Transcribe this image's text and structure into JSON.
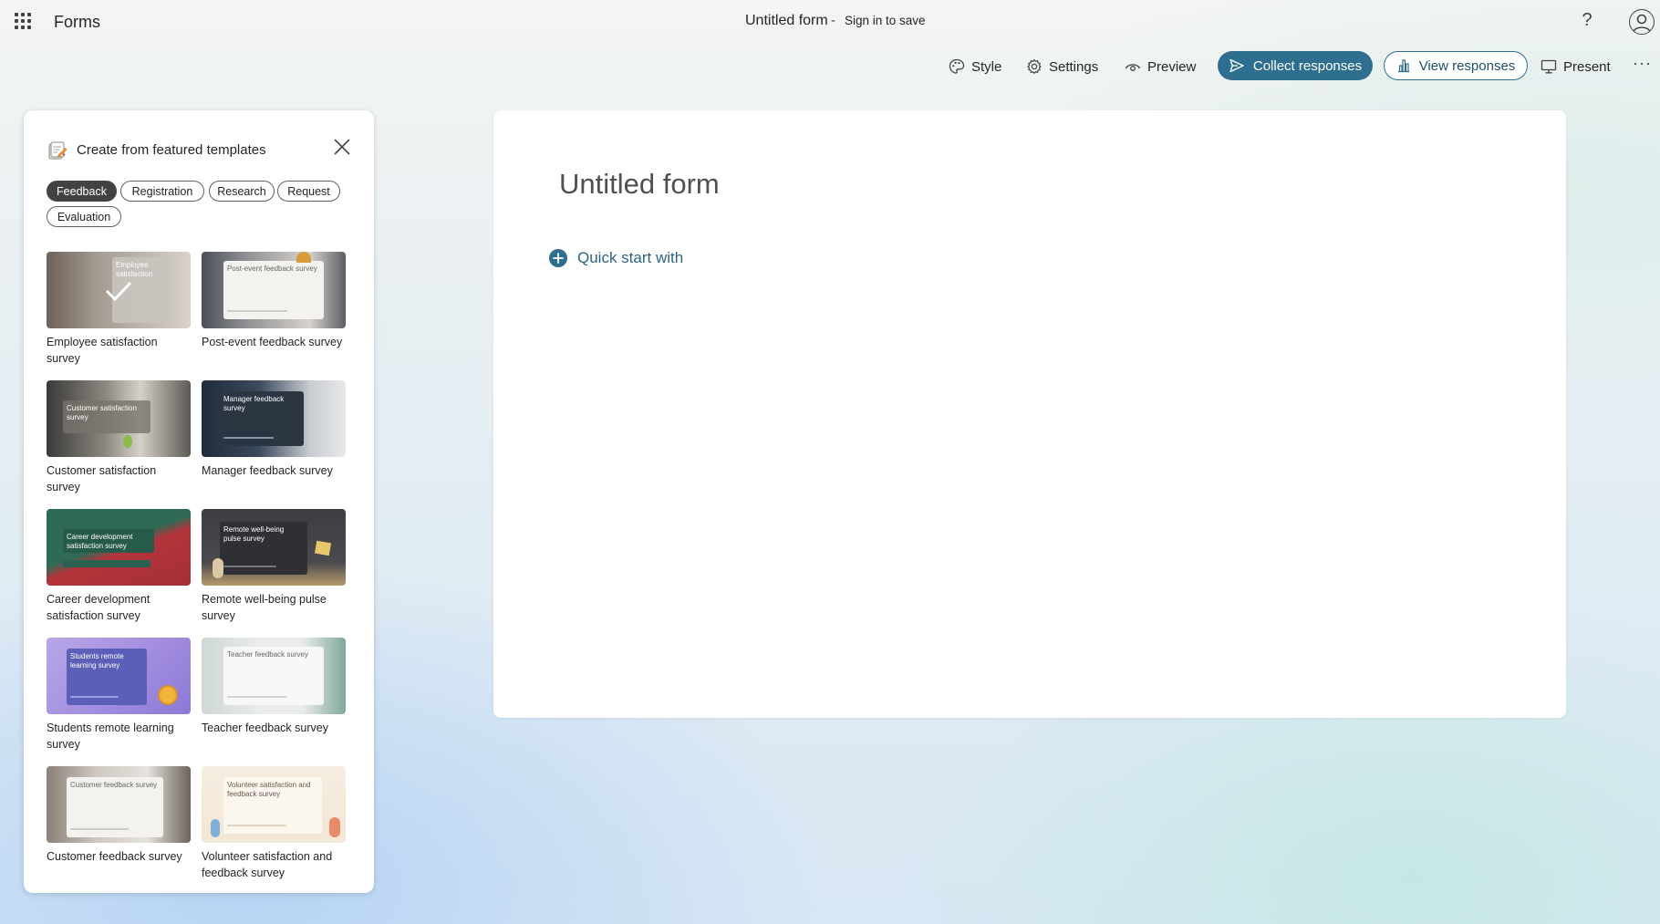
{
  "app": {
    "name": "Forms"
  },
  "document": {
    "title": "Untitled form",
    "separator": "-",
    "sign_in_text": "Sign in to save"
  },
  "header": {
    "help_label": "?"
  },
  "toolbar": {
    "style_label": "Style",
    "settings_label": "Settings",
    "preview_label": "Preview",
    "collect_label": "Collect responses",
    "view_label": "View responses",
    "present_label": "Present",
    "more_label": "···"
  },
  "templates_panel": {
    "title": "Create from featured templates",
    "categories": [
      {
        "label": "Feedback",
        "active": true
      },
      {
        "label": "Registration",
        "active": false
      },
      {
        "label": "Research",
        "active": false
      },
      {
        "label": "Request",
        "active": false
      },
      {
        "label": "Evaluation",
        "active": false
      }
    ],
    "templates": [
      {
        "label": "Employee satisfaction survey",
        "thumb_text": "Employee satisfaction",
        "selected": true
      },
      {
        "label": "Post-event feedback survey",
        "thumb_text": "Post-event feedback survey"
      },
      {
        "label": "Customer satisfaction survey",
        "thumb_text": "Customer satisfaction survey"
      },
      {
        "label": "Manager feedback survey",
        "thumb_text": "Manager feedback survey"
      },
      {
        "label": "Career development satisfaction survey",
        "thumb_text": "Career development satisfaction survey"
      },
      {
        "label": "Remote well-being pulse survey",
        "thumb_text": "Remote well-being pulse survey"
      },
      {
        "label": "Students remote learning survey",
        "thumb_text": "Students remote learning survey"
      },
      {
        "label": "Teacher feedback survey",
        "thumb_text": "Teacher feedback survey"
      },
      {
        "label": "Customer feedback survey",
        "thumb_text": "Customer feedback survey"
      },
      {
        "label": "Volunteer satisfaction and feedback survey",
        "thumb_text": "Volunteer satisfaction and feedback survey"
      }
    ]
  },
  "form": {
    "title": "Untitled form",
    "quick_start_label": "Quick start with"
  },
  "colors": {
    "accent": "#2e6f8f",
    "accent_text": "#2b6480",
    "active_pill": "#424242"
  }
}
